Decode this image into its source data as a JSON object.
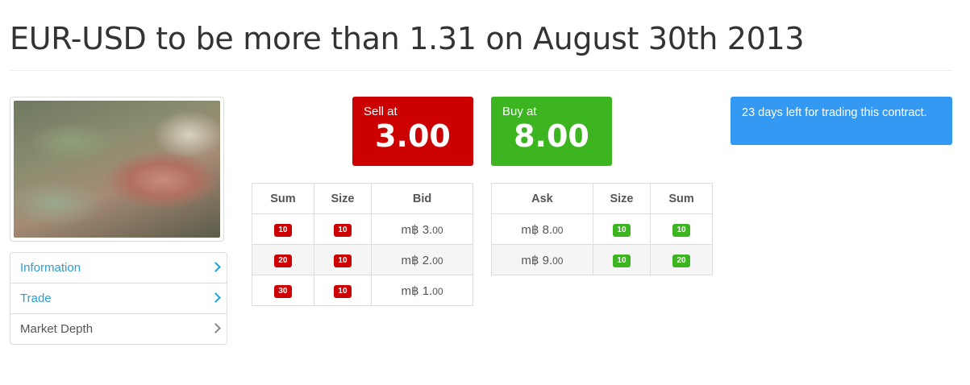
{
  "page": {
    "title": "EUR-USD to be more than 1.31 on August 30th 2013"
  },
  "sidebar": {
    "items": [
      {
        "label": "Information"
      },
      {
        "label": "Trade"
      },
      {
        "label": "Market Depth"
      }
    ]
  },
  "prices": {
    "sell_label": "Sell at",
    "sell_value": "3.00",
    "buy_label": "Buy at",
    "buy_value": "8.00"
  },
  "notice": {
    "text": "23 days left for trading this contract."
  },
  "bid_table": {
    "headers": [
      "Sum",
      "Size",
      "Bid"
    ],
    "rows": [
      {
        "sum": "10",
        "size": "10",
        "bid_main": "m฿ 3.",
        "bid_cents": "00"
      },
      {
        "sum": "20",
        "size": "10",
        "bid_main": "m฿ 2.",
        "bid_cents": "00"
      },
      {
        "sum": "30",
        "size": "10",
        "bid_main": "m฿ 1.",
        "bid_cents": "00"
      }
    ]
  },
  "ask_table": {
    "headers": [
      "Ask",
      "Size",
      "Sum"
    ],
    "rows": [
      {
        "ask_main": "m฿ 8.",
        "ask_cents": "00",
        "size": "10",
        "sum": "10"
      },
      {
        "ask_main": "m฿ 9.",
        "ask_cents": "00",
        "size": "10",
        "sum": "20"
      }
    ]
  },
  "colors": {
    "sell": "#cc0000",
    "buy": "#3cb521",
    "notice": "#3399f3",
    "link": "#2a9fd6"
  }
}
